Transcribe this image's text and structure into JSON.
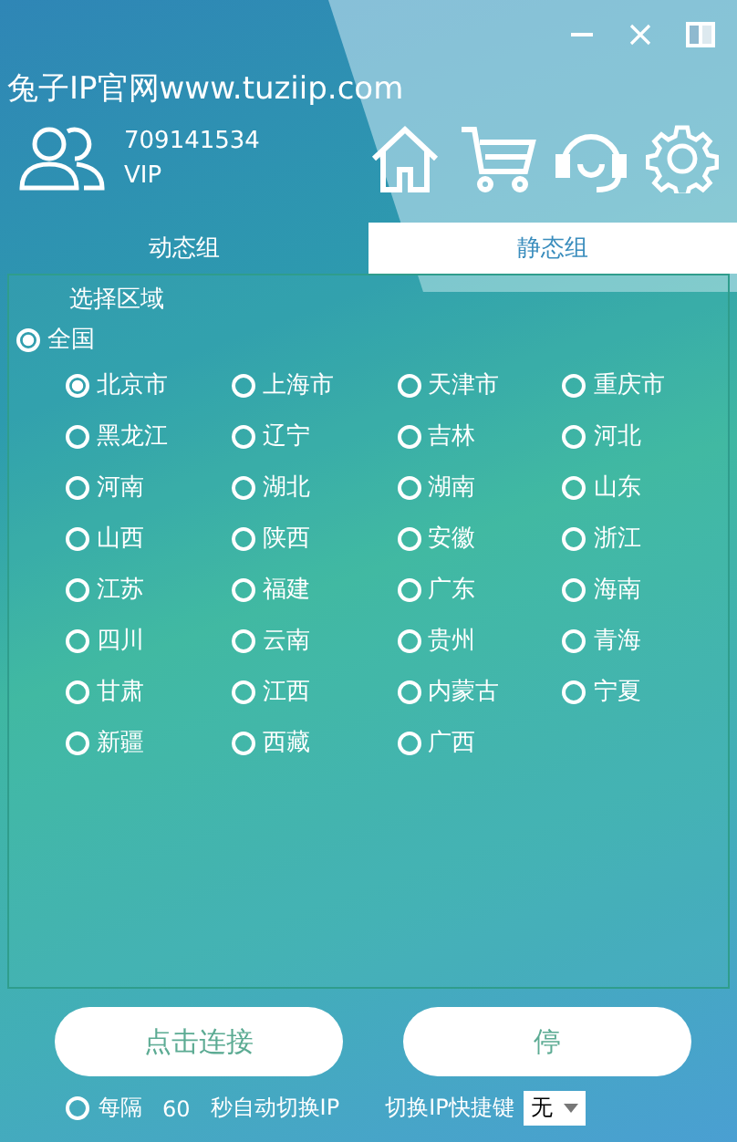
{
  "brand": "兔子IP官网www.tuziip.com",
  "user": {
    "id": "709141534",
    "level": "VIP"
  },
  "tabs": [
    {
      "label": "动态组",
      "selected": false
    },
    {
      "label": "静态组",
      "selected": true
    }
  ],
  "region": {
    "title": "选择区域",
    "all": {
      "label": "全国",
      "selected": true
    },
    "items": [
      {
        "label": "北京市",
        "selected": true
      },
      {
        "label": "上海市",
        "selected": false
      },
      {
        "label": "天津市",
        "selected": false
      },
      {
        "label": "重庆市",
        "selected": false
      },
      {
        "label": "黑龙江",
        "selected": false
      },
      {
        "label": "辽宁",
        "selected": false
      },
      {
        "label": "吉林",
        "selected": false
      },
      {
        "label": "河北",
        "selected": false
      },
      {
        "label": "河南",
        "selected": false
      },
      {
        "label": "湖北",
        "selected": false
      },
      {
        "label": "湖南",
        "selected": false
      },
      {
        "label": "山东",
        "selected": false
      },
      {
        "label": "山西",
        "selected": false
      },
      {
        "label": "陕西",
        "selected": false
      },
      {
        "label": "安徽",
        "selected": false
      },
      {
        "label": "浙江",
        "selected": false
      },
      {
        "label": "江苏",
        "selected": false
      },
      {
        "label": "福建",
        "selected": false
      },
      {
        "label": "广东",
        "selected": false
      },
      {
        "label": "海南",
        "selected": false
      },
      {
        "label": "四川",
        "selected": false
      },
      {
        "label": "云南",
        "selected": false
      },
      {
        "label": "贵州",
        "selected": false
      },
      {
        "label": "青海",
        "selected": false
      },
      {
        "label": "甘肃",
        "selected": false
      },
      {
        "label": "江西",
        "selected": false
      },
      {
        "label": "内蒙古",
        "selected": false
      },
      {
        "label": "宁夏",
        "selected": false
      },
      {
        "label": "新疆",
        "selected": false
      },
      {
        "label": "西藏",
        "selected": false
      },
      {
        "label": "广西",
        "selected": false
      }
    ]
  },
  "buttons": [
    "点击连接",
    "停"
  ],
  "auto_switch": {
    "selected": false,
    "prefix": "每隔",
    "interval": "60",
    "suffix": "秒自动切换IP"
  },
  "hotkey": {
    "label": "切换IP快捷键",
    "value": "无"
  }
}
